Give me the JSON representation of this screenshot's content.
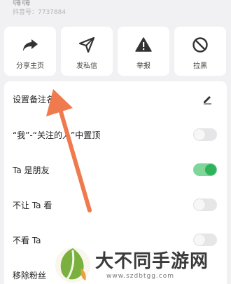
{
  "header": {
    "name": "嗨嗨",
    "id_text": "抖音号：7737884"
  },
  "actions": [
    {
      "label": "分享主页",
      "icon": "share-icon"
    },
    {
      "label": "发私信",
      "icon": "send-icon"
    },
    {
      "label": "举报",
      "icon": "warning-icon"
    },
    {
      "label": "拉黑",
      "icon": "block-icon"
    }
  ],
  "settings": [
    {
      "label": "设置备注名",
      "control": "edit"
    },
    {
      "label": "“我”-“关注的人”中置顶",
      "control": "toggle",
      "on": false
    },
    {
      "label": "Ta 是朋友",
      "control": "toggle",
      "on": true
    },
    {
      "label": "不让 Ta 看",
      "control": "toggle",
      "on": false
    },
    {
      "label": "不看 Ta",
      "control": "toggle",
      "on": false
    },
    {
      "label": "移除粉丝",
      "control": "none"
    }
  ],
  "watermark": {
    "name": "大不同手游网",
    "domain": "www.szdbtgg.com"
  },
  "colors": {
    "toggle_on": "#2fb35a",
    "arrow": "#ef7a4e"
  }
}
